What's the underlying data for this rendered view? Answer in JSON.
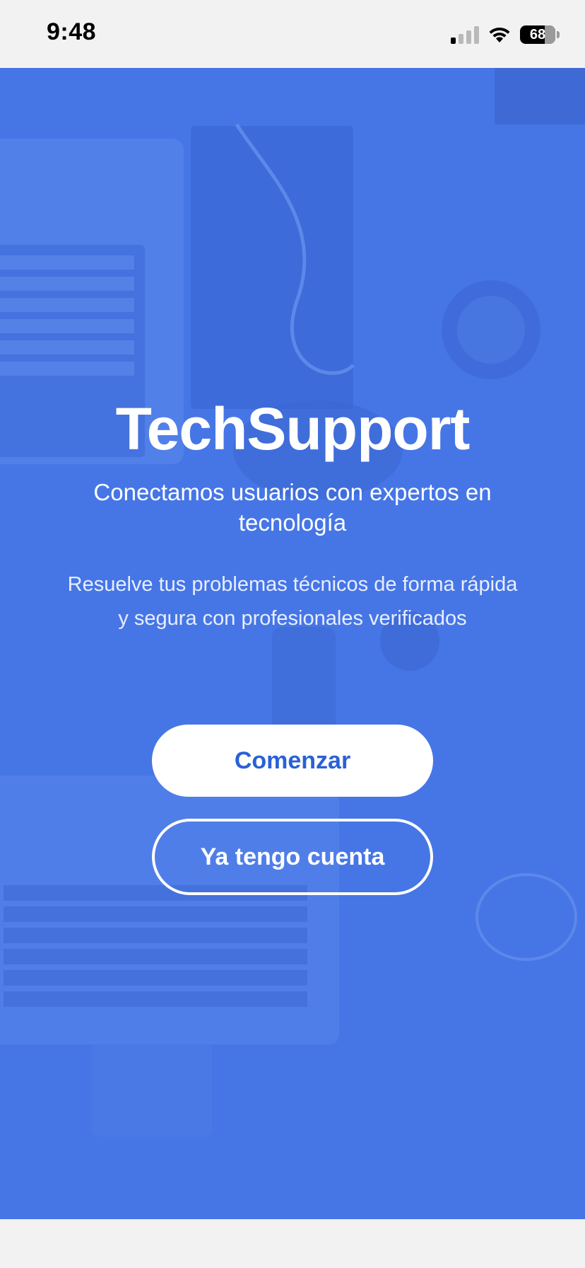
{
  "status_bar": {
    "time": "9:48",
    "battery": "68",
    "icons": [
      "signal-icon",
      "wifi-icon",
      "battery-icon"
    ]
  },
  "welcome": {
    "title": "TechSupport",
    "tagline": "Conectamos usuarios con expertos en tecnología",
    "description": "Resuelve tus problemas técnicos de forma rápida y segura con profesionales verificados",
    "primary_button": "Comenzar",
    "secondary_button": "Ya tengo cuenta"
  },
  "colors": {
    "brand_blue": "#4676e6",
    "button_text_blue": "#2a60d8",
    "white": "#ffffff",
    "status_bar_bg": "#f2f2f2"
  }
}
